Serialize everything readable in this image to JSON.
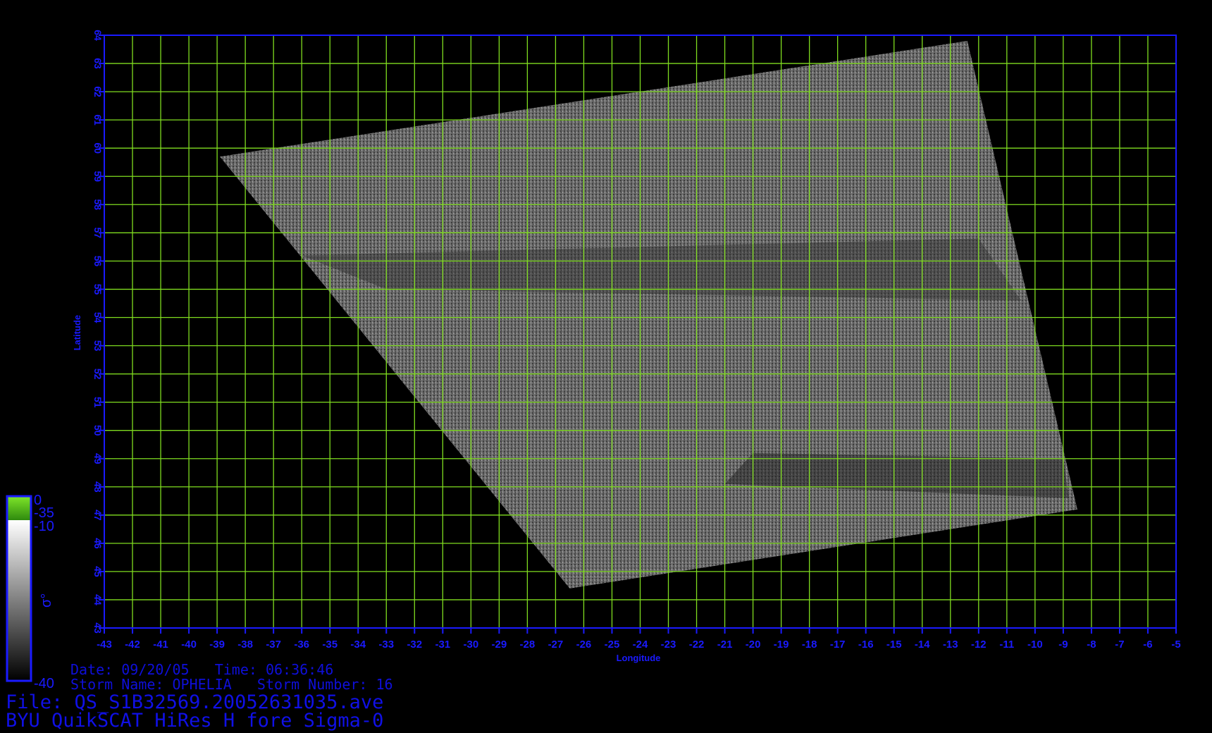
{
  "axes": {
    "x_label": "Longitude",
    "y_label": "Latitude",
    "x_ticks": [
      "-43",
      "-42",
      "-41",
      "-40",
      "-39",
      "-38",
      "-37",
      "-36",
      "-35",
      "-34",
      "-33",
      "-32",
      "-31",
      "-30",
      "-29",
      "-28",
      "-27",
      "-26",
      "-25",
      "-24",
      "-23",
      "-22",
      "-21",
      "-20",
      "-19",
      "-18",
      "-17",
      "-16",
      "-15",
      "-14",
      "-13",
      "-12",
      "-11",
      "-10",
      "-9",
      "-8",
      "-7",
      "-6",
      "-5"
    ],
    "y_ticks": [
      "43",
      "44",
      "45",
      "46",
      "47",
      "48",
      "49",
      "50",
      "51",
      "52",
      "53",
      "54",
      "55",
      "56",
      "57",
      "58",
      "59",
      "60",
      "61",
      "62",
      "63",
      "64"
    ],
    "x_range": [
      -43,
      -5
    ],
    "y_range": [
      43,
      64
    ],
    "grid": true
  },
  "swath": {
    "corners": [
      [
        -38.9,
        59.7
      ],
      [
        -12.4,
        63.8
      ],
      [
        -8.5,
        47.2
      ],
      [
        -26.5,
        44.4
      ]
    ],
    "description_color": "grey"
  },
  "colorbar": {
    "symbol": "σ°",
    "labels": [
      "0",
      "-35",
      "-10",
      "-40"
    ],
    "green_segment": {
      "top": 0,
      "bottom": -35
    },
    "grey_segment": {
      "top": -10,
      "bottom": -40
    }
  },
  "info": {
    "date_time": "Date: 09/20/05   Time: 06:36:46",
    "storm": "Storm Name: OPHELIA   Storm Number: 16",
    "file": "File: QS_S1B32569.20052631035.ave",
    "title": "BYU QuikSCAT HiRes H fore Sigma-0"
  },
  "colors": {
    "grid": "#7fdc1f",
    "axis": "#1a1aff",
    "background": "#000000"
  }
}
